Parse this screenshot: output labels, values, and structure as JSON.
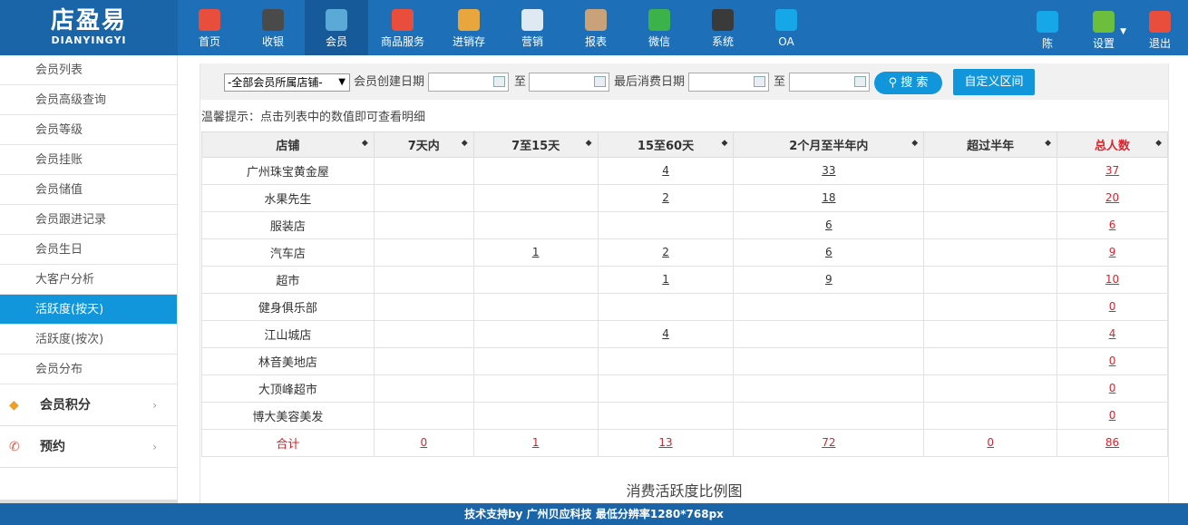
{
  "logo": {
    "cn": "店盈易",
    "en": "DIANYINGYI"
  },
  "nav": [
    {
      "label": "首页",
      "icon": "home-icon",
      "color": "#e94e3c"
    },
    {
      "label": "收银",
      "icon": "cashier-icon",
      "color": "#4a4a4a"
    },
    {
      "label": "会员",
      "icon": "member-icon",
      "color": "#5aa9d6"
    },
    {
      "label": "商品服务",
      "icon": "goods-icon",
      "color": "#e94e3c"
    },
    {
      "label": "进销存",
      "icon": "inventory-icon",
      "color": "#e8a63c"
    },
    {
      "label": "营销",
      "icon": "megaphone-icon",
      "color": "#dfe9f2"
    },
    {
      "label": "报表",
      "icon": "report-icon",
      "color": "#c9a27a"
    },
    {
      "label": "微信",
      "icon": "wechat-icon",
      "color": "#3cb34a"
    },
    {
      "label": "系统",
      "icon": "monitor-icon",
      "color": "#3a3a3a"
    },
    {
      "label": "OA",
      "icon": "oa-icon",
      "color": "#16a7e8"
    }
  ],
  "right_nav": [
    {
      "label": "陈",
      "icon": "user-icon",
      "color": "#16a7e8"
    },
    {
      "label": "设置",
      "icon": "settings-icon",
      "color": "#6cbf3c"
    },
    {
      "label": "退出",
      "icon": "logout-icon",
      "color": "#e94e3c"
    }
  ],
  "sidebar": {
    "items": [
      "会员列表",
      "会员高级查询",
      "会员等级",
      "会员挂账",
      "会员储值",
      "会员跟进记录",
      "会员生日",
      "大客户分析",
      "活跃度(按天)",
      "活跃度(按次)",
      "会员分布"
    ],
    "active_index": 8,
    "groups": [
      {
        "label": "会员积分",
        "icon": "tag-icon"
      },
      {
        "label": "预约",
        "icon": "phone-icon"
      }
    ]
  },
  "filter": {
    "store_select": "-全部会员所属店铺-",
    "created_label": "会员创建日期",
    "to1": "至",
    "last_label": "最后消费日期",
    "to2": "至",
    "search_label": "搜 索",
    "custom_label": "自定义区间"
  },
  "tip": "温馨提示：点击列表中的数值即可查看明细",
  "table": {
    "headers": [
      "店铺",
      "7天内",
      "7至15天",
      "15至60天",
      "2个月至半年内",
      "超过半年",
      "总人数"
    ],
    "rows": [
      [
        "广州珠宝黄金屋",
        "",
        "",
        "4",
        "33",
        "",
        "37"
      ],
      [
        "水果先生",
        "",
        "",
        "2",
        "18",
        "",
        "20"
      ],
      [
        "服装店",
        "",
        "",
        "",
        "6",
        "",
        "6"
      ],
      [
        "汽车店",
        "",
        "1",
        "2",
        "6",
        "",
        "9"
      ],
      [
        "超市",
        "",
        "",
        "1",
        "9",
        "",
        "10"
      ],
      [
        "健身俱乐部",
        "",
        "",
        "",
        "",
        "",
        "0"
      ],
      [
        "江山城店",
        "",
        "",
        "4",
        "",
        "",
        "4"
      ],
      [
        "林音美地店",
        "",
        "",
        "",
        "",
        "",
        "0"
      ],
      [
        "大顶峰超市",
        "",
        "",
        "",
        "",
        "",
        "0"
      ],
      [
        "博大美容美发",
        "",
        "",
        "",
        "",
        "",
        "0"
      ]
    ],
    "sum": [
      "合计",
      "0",
      "1",
      "13",
      "72",
      "0",
      "86"
    ]
  },
  "chart_title": "消费活跃度比例图",
  "footer": "技术支持by 广州贝应科技    最低分辨率1280*768px"
}
